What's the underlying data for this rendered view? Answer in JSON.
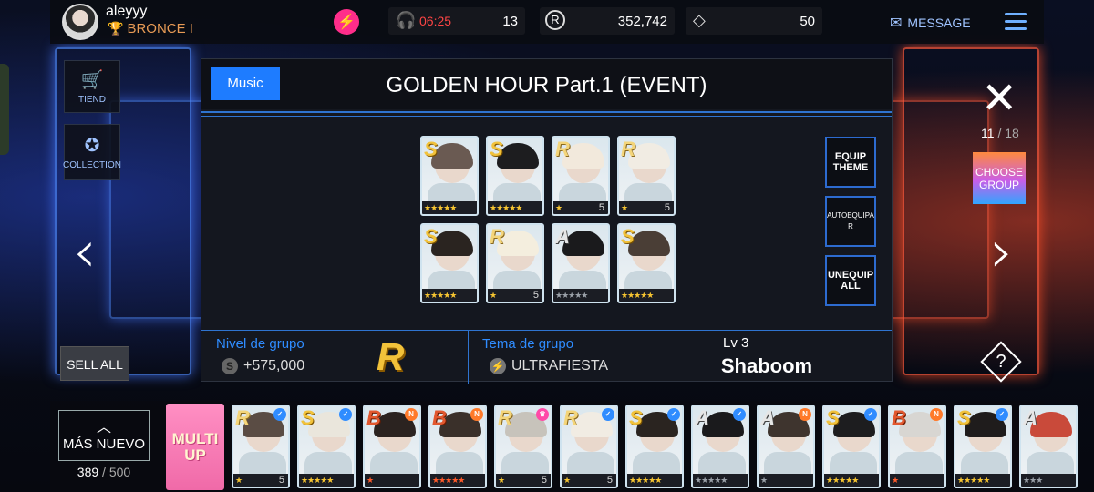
{
  "header": {
    "username": "aleyyy",
    "rank": "BRONCE I",
    "timer": "06:25",
    "energy": "13",
    "currency_r": "352,742",
    "diamonds": "50",
    "message_label": "MESSAGE"
  },
  "left_menu": {
    "shop_label": "TIEND",
    "collection_label": "COLLECTION",
    "sell_all_label": "SELL ALL"
  },
  "panel": {
    "tag": "Music",
    "title": "GOLDEN HOUR Part.1 (EVENT)",
    "equip_theme": "EQUIP THEME",
    "auto_equip": "AUTOEQUIPA R",
    "unequip_all": "UNEQUIP ALL",
    "group_level_label": "Nivel de grupo",
    "group_level_bonus": "+575,000",
    "group_grade": "R",
    "theme_label": "Tema de grupo",
    "theme_name": "ULTRAFIESTA",
    "level": "Lv 3",
    "song": "Shaboom",
    "cards": [
      {
        "grade": "S",
        "stars": "★★★★★",
        "num": "",
        "hair": "#6a5a52"
      },
      {
        "grade": "S",
        "stars": "★★★★★",
        "num": "",
        "hair": "#1d1d1f"
      },
      {
        "grade": "R",
        "stars": "★",
        "num": "5",
        "hair": "#f2e9dc"
      },
      {
        "grade": "R",
        "stars": "★",
        "num": "5",
        "hair": "#f1ece3"
      },
      {
        "grade": "S",
        "stars": "★★★★★",
        "num": "",
        "hair": "#2a2420"
      },
      {
        "grade": "R",
        "stars": "★",
        "num": "5",
        "hair": "#f4eede"
      },
      {
        "grade": "A",
        "stars": "★★★★★",
        "num": "",
        "hair": "#1a1a1c"
      },
      {
        "grade": "S",
        "stars": "★★★★★",
        "num": "",
        "hair": "#4a3e36"
      }
    ]
  },
  "right_menu": {
    "page_current": "11",
    "page_total": "/ 18",
    "choose_group": "CHOOSE GROUP",
    "help_symbol": "?"
  },
  "bottom": {
    "sort_label": "MÁS NUEVO",
    "inventory_count": "389",
    "inventory_max": "/ 500",
    "multiup_line1": "MULTI",
    "multiup_line2": "UP",
    "cards": [
      {
        "grade": "R",
        "stars": "★",
        "num": "5",
        "badge": "check",
        "hair": "#5a4c44"
      },
      {
        "grade": "S",
        "stars": "★★★★★",
        "num": "",
        "badge": "check",
        "hair": "#eae6dc"
      },
      {
        "grade": "B",
        "stars": "★",
        "num": "",
        "badge": "n",
        "hair": "#2b2320"
      },
      {
        "grade": "B",
        "stars": "★★★★★",
        "num": "",
        "badge": "n",
        "hair": "#3a302a"
      },
      {
        "grade": "R",
        "stars": "★",
        "num": "5",
        "badge": "crown",
        "hair": "#c7c3bb"
      },
      {
        "grade": "R",
        "stars": "★",
        "num": "5",
        "badge": "check",
        "hair": "#f1ece3"
      },
      {
        "grade": "S",
        "stars": "★★★★★",
        "num": "",
        "badge": "check",
        "hair": "#2a2420"
      },
      {
        "grade": "A",
        "stars": "★★★★★",
        "num": "",
        "badge": "check",
        "hair": "#1a1a1c"
      },
      {
        "grade": "A",
        "stars": "★",
        "num": "",
        "badge": "n",
        "hair": "#3e342e"
      },
      {
        "grade": "S",
        "stars": "★★★★★",
        "num": "",
        "badge": "check",
        "hair": "#1d1d1f"
      },
      {
        "grade": "B",
        "stars": "★",
        "num": "",
        "badge": "n",
        "hair": "#d8d6d2"
      },
      {
        "grade": "S",
        "stars": "★★★★★",
        "num": "",
        "badge": "check",
        "hair": "#1f1c1c"
      },
      {
        "grade": "A",
        "stars": "★★★",
        "num": "",
        "badge": "",
        "hair": "#c94a3a"
      }
    ]
  }
}
